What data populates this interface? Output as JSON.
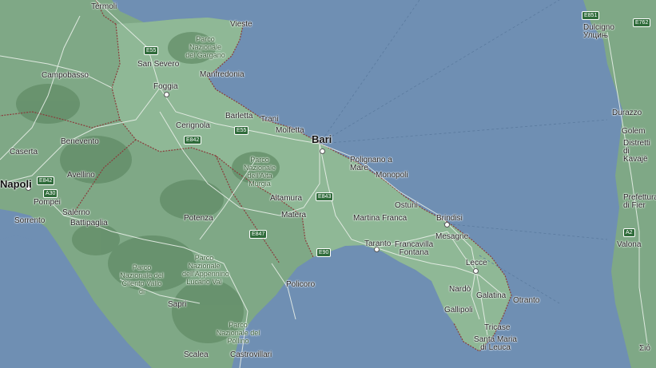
{
  "colors": {
    "sea": "#6f8fb3",
    "land": "#7fa886",
    "land_dark": "#5f8a64",
    "puglia": "#8fb896",
    "road": "#e8efe8",
    "border": "#8a3b3b",
    "shield": "#2f6b3a"
  },
  "cities_big": [
    {
      "id": "bari",
      "name": "Bari"
    },
    {
      "id": "napoli",
      "name": "Napoli"
    }
  ],
  "cities": [
    {
      "id": "termoli",
      "name": "Termoli"
    },
    {
      "id": "vieste",
      "name": "Vieste"
    },
    {
      "id": "san-severo",
      "name": "San Severo"
    },
    {
      "id": "manfredonia",
      "name": "Manfredonia"
    },
    {
      "id": "campobasso",
      "name": "Campobasso"
    },
    {
      "id": "foggia",
      "name": "Foggia"
    },
    {
      "id": "cerignola",
      "name": "Cerignola"
    },
    {
      "id": "barletta",
      "name": "Barletta"
    },
    {
      "id": "trani",
      "name": "Trani"
    },
    {
      "id": "molfetta",
      "name": "Molfetta"
    },
    {
      "id": "benevento",
      "name": "Benevento"
    },
    {
      "id": "caserta",
      "name": "Caserta"
    },
    {
      "id": "avellino",
      "name": "Avellino"
    },
    {
      "id": "pompei",
      "name": "Pompei"
    },
    {
      "id": "sorrento",
      "name": "Sorrento"
    },
    {
      "id": "salerno",
      "name": "Salerno"
    },
    {
      "id": "battipaglia",
      "name": "Battipaglia"
    },
    {
      "id": "potenza",
      "name": "Potenza"
    },
    {
      "id": "altamura",
      "name": "Altamura"
    },
    {
      "id": "matera",
      "name": "Matera"
    },
    {
      "id": "polignano",
      "name": "Polignano a Mare"
    },
    {
      "id": "monopoli",
      "name": "Monopoli"
    },
    {
      "id": "ostuni",
      "name": "Ostuni"
    },
    {
      "id": "martina",
      "name": "Martina Franca"
    },
    {
      "id": "brindisi",
      "name": "Brindisi"
    },
    {
      "id": "mesagne",
      "name": "Mesagne"
    },
    {
      "id": "francavilla",
      "name": "Francavilla Fontana"
    },
    {
      "id": "taranto",
      "name": "Taranto"
    },
    {
      "id": "lecce",
      "name": "Lecce"
    },
    {
      "id": "nardo",
      "name": "Nardò"
    },
    {
      "id": "galatina",
      "name": "Galatina"
    },
    {
      "id": "gallipoli",
      "name": "Gallipoli"
    },
    {
      "id": "otranto",
      "name": "Otranto"
    },
    {
      "id": "tricase",
      "name": "Tricase"
    },
    {
      "id": "santa-maria",
      "name": "Santa Maria di Leuca"
    },
    {
      "id": "policoro",
      "name": "Policoro"
    },
    {
      "id": "sapri",
      "name": "Sapri"
    },
    {
      "id": "scalea",
      "name": "Scalea"
    },
    {
      "id": "castrovillari",
      "name": "Castrovillari"
    },
    {
      "id": "dulcigno",
      "name": "Dulcigno Улцињ"
    },
    {
      "id": "durazzo",
      "name": "Durazzo"
    },
    {
      "id": "golem",
      "name": "Golem"
    },
    {
      "id": "kavaje",
      "name": "Distretti di Kavajë"
    },
    {
      "id": "fier",
      "name": "Prefettura di Fier"
    },
    {
      "id": "valona",
      "name": "Valona"
    },
    {
      "id": "sigma",
      "name": "Σιό"
    }
  ],
  "parks": [
    {
      "id": "gargano",
      "name": "Parco Nazionale del Gargano"
    },
    {
      "id": "alta-murgia",
      "name": "Parco Nazionale dell'Alta Murgia"
    },
    {
      "id": "cilento",
      "name": "Parco Nazionale del Cilento Vallo di"
    },
    {
      "id": "appennino",
      "name": "Parco Nazionale dell'Appennino Lucano Val"
    },
    {
      "id": "pollino",
      "name": "Parco Nazionale del Pollino"
    }
  ],
  "shields": [
    {
      "id": "e55-north",
      "name": "E55"
    },
    {
      "id": "e55-mid",
      "name": "E55"
    },
    {
      "id": "e842-a",
      "name": "E842"
    },
    {
      "id": "e842-b",
      "name": "E842"
    },
    {
      "id": "a30",
      "name": "A30"
    },
    {
      "id": "e843",
      "name": "E843"
    },
    {
      "id": "e847",
      "name": "E847"
    },
    {
      "id": "e90",
      "name": "E90"
    },
    {
      "id": "e851",
      "name": "E851"
    },
    {
      "id": "e762",
      "name": "E762"
    },
    {
      "id": "a2",
      "name": "A2"
    }
  ]
}
